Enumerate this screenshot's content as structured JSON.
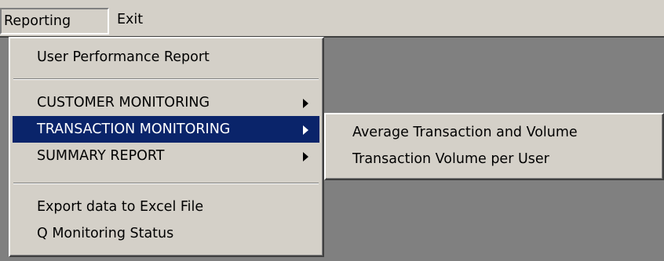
{
  "menubar": {
    "items": [
      {
        "label": "Reporting",
        "open": true
      },
      {
        "label": "Exit"
      }
    ]
  },
  "reporting_menu": {
    "items": [
      {
        "label": "User Performance Report"
      },
      {
        "label": "CUSTOMER MONITORING",
        "submenu": true
      },
      {
        "label": "TRANSACTION MONITORING",
        "submenu": true,
        "selected": true
      },
      {
        "label": "SUMMARY REPORT",
        "submenu": true
      },
      {
        "label": "Export data to Excel File"
      },
      {
        "label": "Q Monitoring Status"
      }
    ]
  },
  "transaction_submenu": {
    "items": [
      {
        "label": "Average Transaction and Volume"
      },
      {
        "label": "Transaction Volume per User"
      }
    ]
  },
  "colors": {
    "menu_face": "#d4d0c8",
    "highlight": "#0a246a",
    "highlight_text": "#ffffff",
    "client_background": "#808080"
  }
}
